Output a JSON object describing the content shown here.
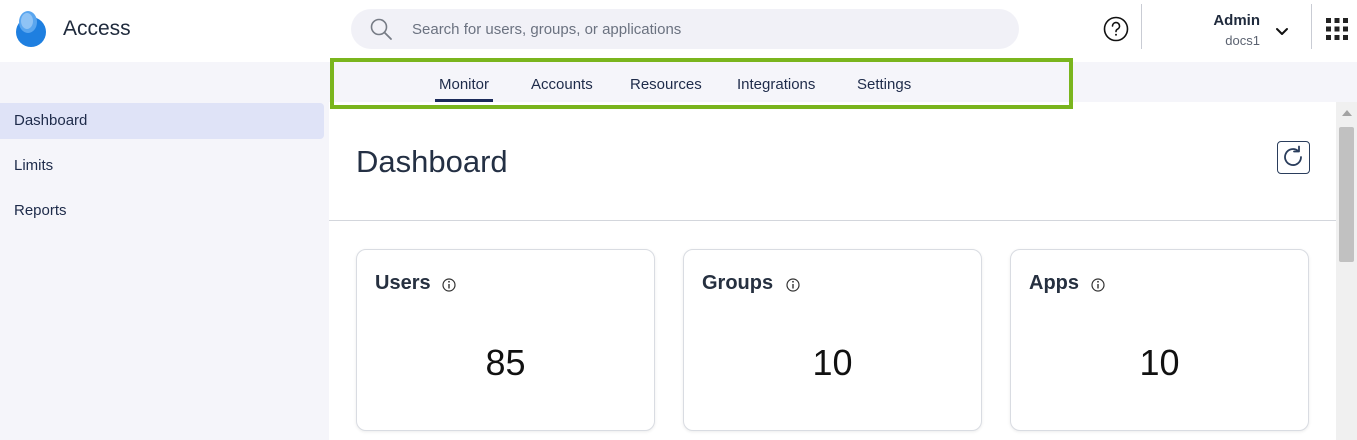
{
  "app": {
    "title": "Access"
  },
  "search": {
    "placeholder": "Search for users, groups, or applications",
    "value": ""
  },
  "user": {
    "name": "Admin",
    "org": "docs1"
  },
  "nav": {
    "tabs": [
      {
        "label": "Monitor",
        "active": true
      },
      {
        "label": "Accounts",
        "active": false
      },
      {
        "label": "Resources",
        "active": false
      },
      {
        "label": "Integrations",
        "active": false
      },
      {
        "label": "Settings",
        "active": false
      }
    ]
  },
  "sidebar": {
    "items": [
      {
        "label": "Dashboard",
        "active": true
      },
      {
        "label": "Limits",
        "active": false
      },
      {
        "label": "Reports",
        "active": false
      }
    ]
  },
  "main": {
    "title": "Dashboard",
    "cards": [
      {
        "title": "Users",
        "value": "85"
      },
      {
        "title": "Groups",
        "value": "10"
      },
      {
        "title": "Apps",
        "value": "10"
      }
    ]
  },
  "icons": {
    "logo": "access-logo-icon",
    "search": "search-icon",
    "help": "help-circle-icon",
    "chevron": "chevron-down-icon",
    "apps": "app-grid-icon",
    "refresh": "refresh-icon",
    "info": "info-icon"
  },
  "colors": {
    "nav_highlight_border": "#7ab51d",
    "active_sidebar_bg": "#dfe3f7",
    "active_tab_underline": "#1b2a5a",
    "logo_blue": "#1e7fe0"
  }
}
